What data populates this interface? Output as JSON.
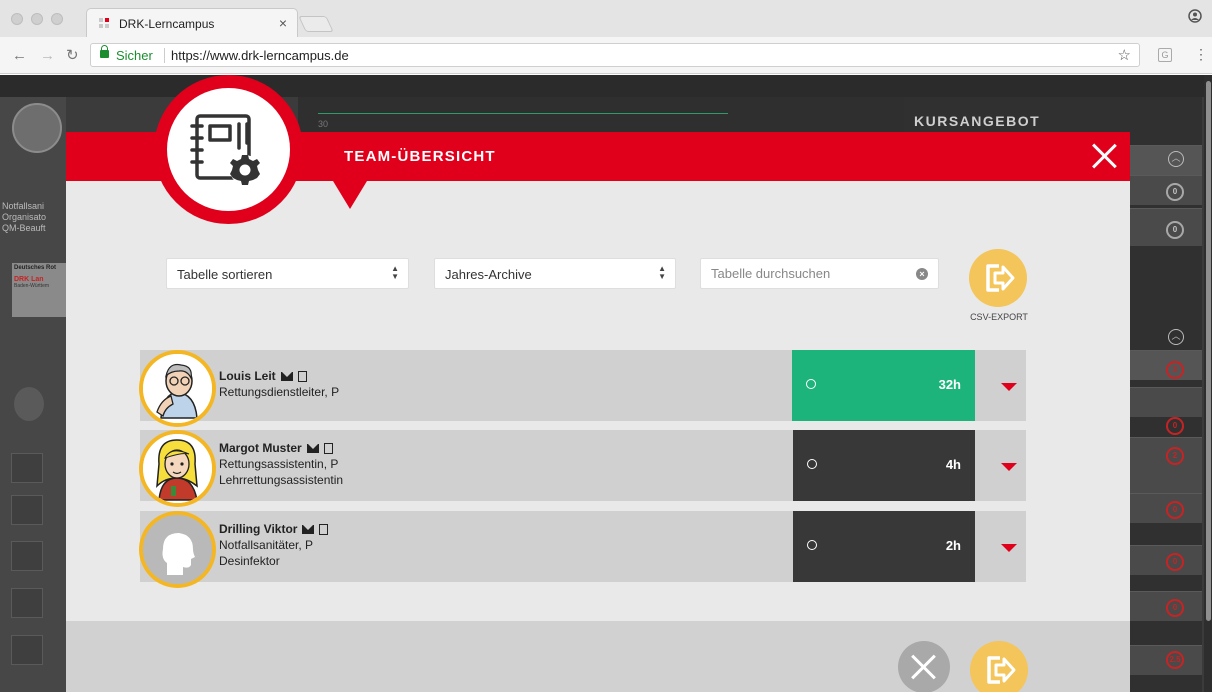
{
  "browser": {
    "tab_title": "DRK-Lerncampus",
    "tab_close": "×",
    "secure_label": "Sicher",
    "url": "https://www.drk-lerncampus.de",
    "star": "☆",
    "ext_label": "G"
  },
  "background": {
    "kursangebot": "KURSANGEBOT",
    "chart_tick": "30",
    "roles": [
      "Notfallsani",
      "Organisato",
      "QM-Beauft"
    ],
    "logo_lines": [
      "Deutsches Rot",
      "DRK Lan",
      "Baden-Württem"
    ],
    "timers": [
      {
        "label": "0",
        "color": "gray"
      },
      {
        "label": "0",
        "color": "gray"
      },
      {
        "label": "3",
        "color": "red"
      },
      {
        "label": "0",
        "color": "red"
      },
      {
        "label": "2",
        "color": "red"
      },
      {
        "label": "0",
        "color": "red"
      },
      {
        "label": "0",
        "color": "red"
      },
      {
        "label": "0",
        "color": "red"
      },
      {
        "label": "2.5",
        "color": "red"
      }
    ]
  },
  "modal": {
    "title": "TEAM-ÜBERSICHT",
    "sort_select": "Tabelle sortieren",
    "archive_select": "Jahres-Archive",
    "search_placeholder": "Tabelle durchsuchen",
    "csv_label": "CSV-EXPORT",
    "members": [
      {
        "name": "Louis Leit",
        "lines": [
          "Rettungsdienstleiter, P"
        ],
        "hours": "32h",
        "status_color": "#1cb47a",
        "avatar": "cartoon-man"
      },
      {
        "name": "Margot Muster",
        "lines": [
          "Rettungsassistentin, P",
          "Lehrrettungsassistentin"
        ],
        "hours": "4h",
        "status_color": "#383838",
        "avatar": "cartoon-woman"
      },
      {
        "name": "Drilling Viktor",
        "lines": [
          "Notfallsanitäter, P",
          "Desinfektor"
        ],
        "hours": "2h",
        "status_color": "#383838",
        "avatar": "placeholder-person"
      }
    ]
  },
  "colors": {
    "brand_red": "#e1001b",
    "accent_yellow": "#f3c55a",
    "status_green": "#1cb47a"
  }
}
